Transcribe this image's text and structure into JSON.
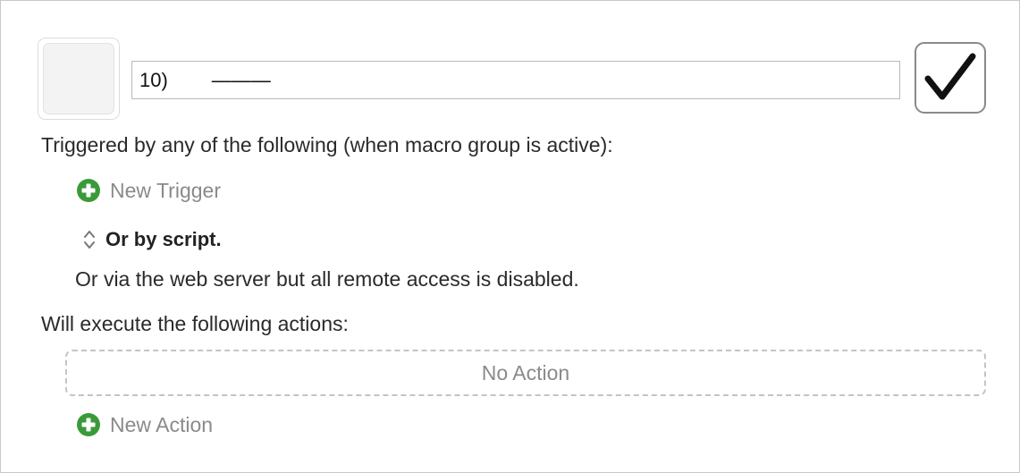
{
  "macro": {
    "name_value": "10)        ———"
  },
  "triggers": {
    "heading": "Triggered by any of the following (when macro group is active):",
    "new_trigger_label": "New Trigger",
    "script_label": "Or by script.",
    "web_server_note": "Or via the web server but all remote access is disabled."
  },
  "actions": {
    "heading": "Will execute the following actions:",
    "empty_label": "No Action",
    "new_action_label": "New Action"
  },
  "icons": {
    "enabled": "checkmark-icon",
    "add": "plus-circle-icon",
    "stepper": "up-down-chevron-icon"
  },
  "colors": {
    "add_green": "#3a9a3a",
    "muted_text": "#8a8a8a",
    "checkbox_border": "#8a8a8a"
  }
}
